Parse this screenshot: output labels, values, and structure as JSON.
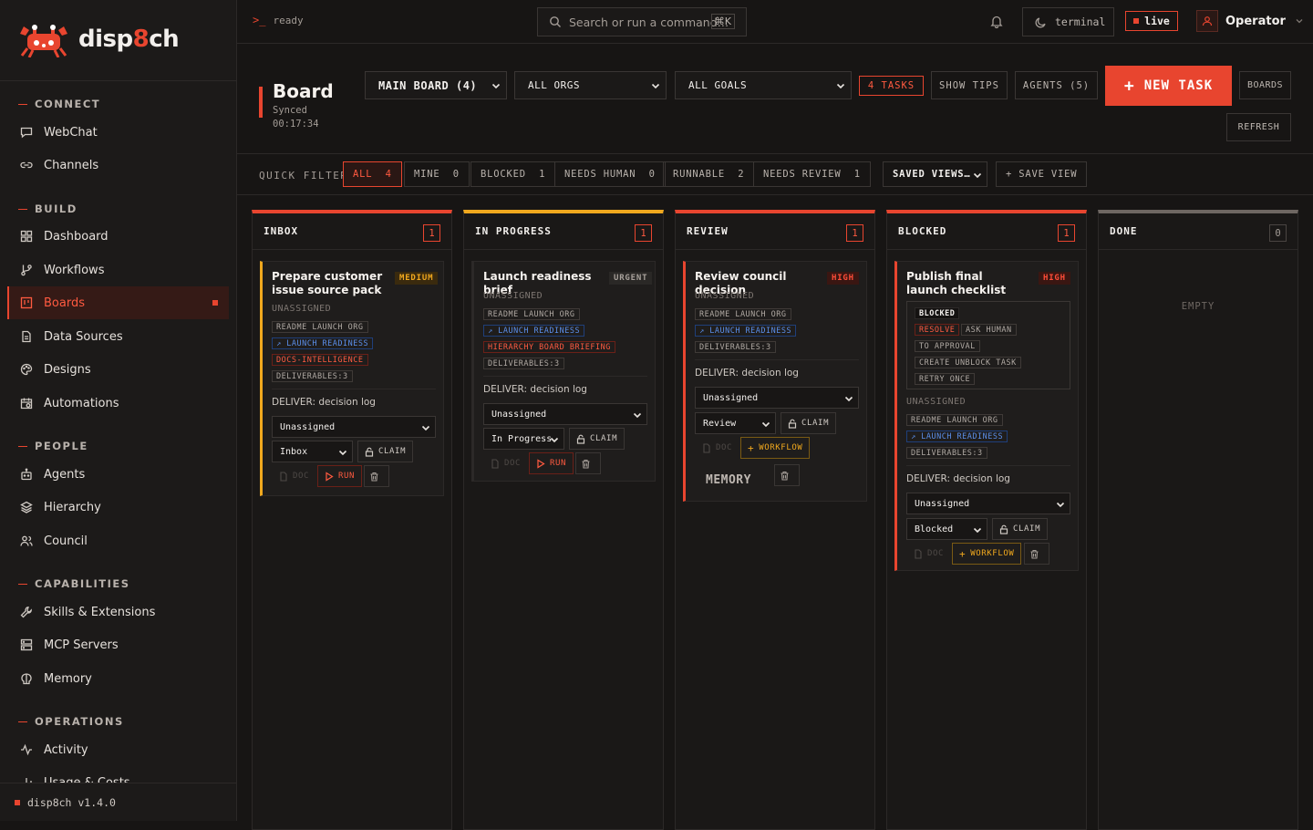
{
  "app": {
    "name_a": "disp",
    "name_b": "8",
    "name_c": "ch",
    "version": "disp8ch v1.4.0"
  },
  "sidebar": {
    "sections": [
      "CONNECT",
      "BUILD",
      "PEOPLE",
      "CAPABILITIES",
      "OPERATIONS"
    ],
    "items": [
      "WebChat",
      "Channels",
      "Dashboard",
      "Workflows",
      "Boards",
      "Data Sources",
      "Designs",
      "Automations",
      "Agents",
      "Hierarchy",
      "Council",
      "Skills & Extensions",
      "MCP Servers",
      "Memory",
      "Activity",
      "Usage & Costs"
    ]
  },
  "topbar": {
    "status": "ready",
    "search_placeholder": "Search or run a command…",
    "search_kbd": "⌘K",
    "theme": "terminal",
    "live": "live",
    "user": "Operator"
  },
  "header": {
    "title": "Board",
    "synced": "Synced",
    "time": "00:17:34",
    "board_select": "MAIN BOARD (4)",
    "org_select": "ALL ORGS",
    "goal_select": "ALL GOALS",
    "tasks": "4 TASKS",
    "show_tips": "SHOW TIPS",
    "agents": "AGENTS (5)",
    "new_task": "NEW TASK",
    "boards": "BOARDS",
    "refresh": "REFRESH"
  },
  "filters": {
    "label": "QUICK FILTER",
    "chips": [
      "ALL  4",
      "MINE  0",
      "BLOCKED  1",
      "NEEDS HUMAN  0",
      "RUNNABLE  2",
      "NEEDS REVIEW  1"
    ],
    "saved": "SAVED VIEWS…",
    "save_view": "+ SAVE VIEW"
  },
  "columns": [
    {
      "name": "INBOX",
      "count": "1"
    },
    {
      "name": "IN PROGRESS",
      "count": "1"
    },
    {
      "name": "REVIEW",
      "count": "1"
    },
    {
      "name": "BLOCKED",
      "count": "1"
    },
    {
      "name": "DONE",
      "count": "0",
      "empty": "EMPTY"
    }
  ],
  "colors": {
    "accent": "#e8452f",
    "inbox_border": "#e8452f",
    "progress_border": "#f0a81e",
    "done_border": "#6e6762",
    "medium": "#f0a81e",
    "blue_tag": "#5b8fea"
  },
  "cards": {
    "inbox": {
      "title": "Prepare customer issue source pack",
      "priority": "MEDIUM",
      "assignee": "UNASSIGNED",
      "tags": [
        "README LAUNCH ORG",
        "↗ LAUNCH READINESS",
        "DOCS-INTELLIGENCE",
        "DELIVERABLES:3"
      ],
      "deliver": "DELIVER: decision log",
      "assign_select": "Unassigned",
      "status_select": "Inbox",
      "claim": "CLAIM",
      "doc": "DOC",
      "run": "RUN"
    },
    "progress": {
      "title": "Launch readiness brief",
      "priority": "URGENT",
      "assignee": "UNASSIGNED",
      "tags": [
        "README LAUNCH ORG",
        "↗ LAUNCH READINESS",
        "HIERARCHY BOARD BRIEFING",
        "DELIVERABLES:3"
      ],
      "deliver": "DELIVER: decision log",
      "assign_select": "Unassigned",
      "status_select": "In Progress",
      "claim": "CLAIM",
      "doc": "DOC",
      "run": "RUN"
    },
    "review": {
      "title": "Review council decision",
      "priority": "HIGH",
      "assignee": "UNASSIGNED",
      "tags": [
        "README LAUNCH ORG",
        "↗ LAUNCH READINESS",
        "DELIVERABLES:3"
      ],
      "deliver": "DELIVER: decision log",
      "assign_select": "Unassigned",
      "status_select": "Review",
      "claim": "CLAIM",
      "doc": "DOC",
      "workflow": "WORKFLOW",
      "memory": "MEMORY"
    },
    "blocked": {
      "title": "Publish final launch checklist",
      "priority": "HIGH",
      "blocked_label": "BLOCKED",
      "actions": [
        "RESOLVE",
        "ASK HUMAN",
        "TO APPROVAL",
        "CREATE UNBLOCK TASK",
        "RETRY ONCE"
      ],
      "assignee": "UNASSIGNED",
      "tags": [
        "README LAUNCH ORG",
        "↗ LAUNCH READINESS",
        "DELIVERABLES:3"
      ],
      "deliver": "DELIVER: decision log",
      "assign_select": "Unassigned",
      "status_select": "Blocked",
      "claim": "CLAIM",
      "doc": "DOC",
      "workflow": "WORKFLOW"
    }
  }
}
